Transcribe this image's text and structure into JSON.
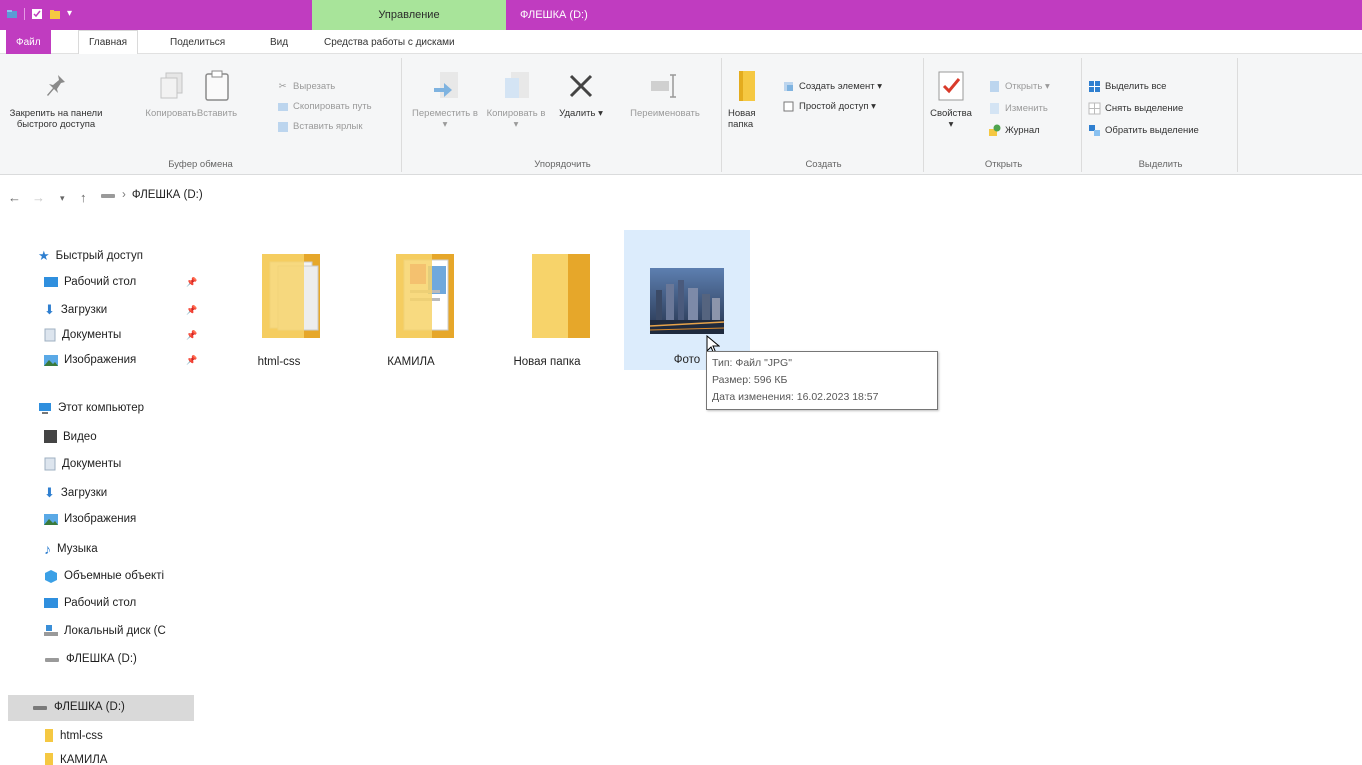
{
  "titlebar": {
    "manage_tab": "Управление",
    "drive_title": "ФЛЕШКА (D:)"
  },
  "tabs": {
    "file": "Файл",
    "home": "Главная",
    "share": "Поделиться",
    "view": "Вид",
    "drive_tools": "Средства работы с дисками"
  },
  "ribbon": {
    "clipboard": {
      "label": "Буфер обмена",
      "pin": "Закрепить на панели быстрого доступа",
      "copy": "Копировать",
      "paste": "Вставить",
      "cut": "Вырезать",
      "copy_path": "Скопировать путь",
      "paste_shortcut": "Вставить ярлык"
    },
    "organize": {
      "label": "Упорядочить",
      "move_to": "Переместить в ▾",
      "copy_to": "Копировать в ▾",
      "delete": "Удалить ▾",
      "rename": "Переименовать"
    },
    "create": {
      "label": "Создать",
      "new_folder": "Новая папка",
      "new_item": "Создать элемент ▾",
      "easy_access": "Простой доступ ▾"
    },
    "open": {
      "label": "Открыть",
      "properties": "Свойства ▾",
      "open": "Открыть ▾",
      "edit": "Изменить",
      "history": "Журнал"
    },
    "select": {
      "label": "Выделить",
      "select_all": "Выделить все",
      "select_none": "Снять выделение",
      "invert": "Обратить выделение"
    }
  },
  "address": {
    "path": "ФЛЕШКА (D:)"
  },
  "navpane": {
    "quick_access": "Быстрый доступ",
    "qa_items": [
      "Рабочий стол",
      "Загрузки",
      "Документы",
      "Изображения"
    ],
    "this_pc": "Этот компьютер",
    "pc_items": [
      "Видео",
      "Документы",
      "Загрузки",
      "Изображения",
      "Музыка",
      "Объемные объекті",
      "Рабочий стол",
      "Локальный диск (C",
      "ФЛЕШКА (D:)"
    ],
    "drive": "ФЛЕШКА (D:)",
    "drive_items": [
      "html-css",
      "КАМИЛА"
    ]
  },
  "files": [
    {
      "name": "html-css",
      "type": "folder"
    },
    {
      "name": "КАМИЛА",
      "type": "folder"
    },
    {
      "name": "Новая папка",
      "type": "folder"
    },
    {
      "name": "Фото",
      "type": "image"
    }
  ],
  "tooltip": {
    "type_line": "Тип: Файл \"JPG\"",
    "size_line": "Размер: 596 КБ",
    "date_line": "Дата изменения: 16.02.2023 18:57"
  },
  "colors": {
    "titlebar": "#c03cc0",
    "manage_tab": "#a8e49a",
    "selection": "#dcecfc",
    "folder": "#f2c94c"
  }
}
